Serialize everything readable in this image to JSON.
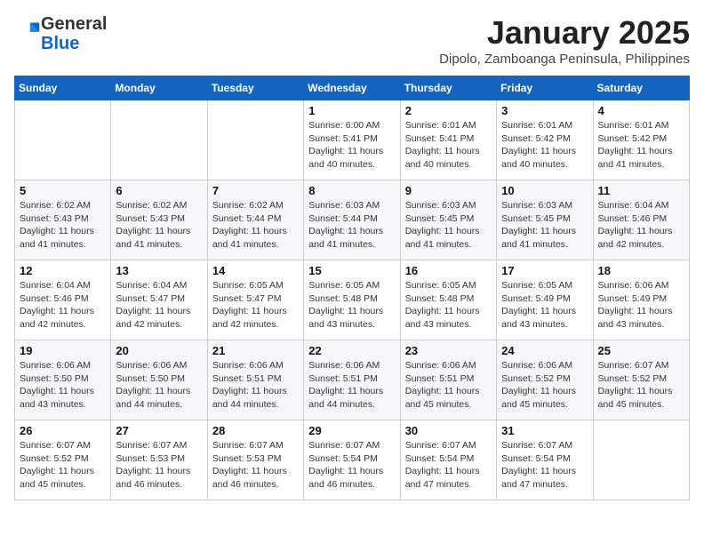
{
  "header": {
    "logo_general": "General",
    "logo_blue": "Blue",
    "month": "January 2025",
    "location": "Dipolo, Zamboanga Peninsula, Philippines"
  },
  "weekdays": [
    "Sunday",
    "Monday",
    "Tuesday",
    "Wednesday",
    "Thursday",
    "Friday",
    "Saturday"
  ],
  "weeks": [
    [
      {
        "day": "",
        "info": ""
      },
      {
        "day": "",
        "info": ""
      },
      {
        "day": "",
        "info": ""
      },
      {
        "day": "1",
        "info": "Sunrise: 6:00 AM\nSunset: 5:41 PM\nDaylight: 11 hours\nand 40 minutes."
      },
      {
        "day": "2",
        "info": "Sunrise: 6:01 AM\nSunset: 5:41 PM\nDaylight: 11 hours\nand 40 minutes."
      },
      {
        "day": "3",
        "info": "Sunrise: 6:01 AM\nSunset: 5:42 PM\nDaylight: 11 hours\nand 40 minutes."
      },
      {
        "day": "4",
        "info": "Sunrise: 6:01 AM\nSunset: 5:42 PM\nDaylight: 11 hours\nand 41 minutes."
      }
    ],
    [
      {
        "day": "5",
        "info": "Sunrise: 6:02 AM\nSunset: 5:43 PM\nDaylight: 11 hours\nand 41 minutes."
      },
      {
        "day": "6",
        "info": "Sunrise: 6:02 AM\nSunset: 5:43 PM\nDaylight: 11 hours\nand 41 minutes."
      },
      {
        "day": "7",
        "info": "Sunrise: 6:02 AM\nSunset: 5:44 PM\nDaylight: 11 hours\nand 41 minutes."
      },
      {
        "day": "8",
        "info": "Sunrise: 6:03 AM\nSunset: 5:44 PM\nDaylight: 11 hours\nand 41 minutes."
      },
      {
        "day": "9",
        "info": "Sunrise: 6:03 AM\nSunset: 5:45 PM\nDaylight: 11 hours\nand 41 minutes."
      },
      {
        "day": "10",
        "info": "Sunrise: 6:03 AM\nSunset: 5:45 PM\nDaylight: 11 hours\nand 41 minutes."
      },
      {
        "day": "11",
        "info": "Sunrise: 6:04 AM\nSunset: 5:46 PM\nDaylight: 11 hours\nand 42 minutes."
      }
    ],
    [
      {
        "day": "12",
        "info": "Sunrise: 6:04 AM\nSunset: 5:46 PM\nDaylight: 11 hours\nand 42 minutes."
      },
      {
        "day": "13",
        "info": "Sunrise: 6:04 AM\nSunset: 5:47 PM\nDaylight: 11 hours\nand 42 minutes."
      },
      {
        "day": "14",
        "info": "Sunrise: 6:05 AM\nSunset: 5:47 PM\nDaylight: 11 hours\nand 42 minutes."
      },
      {
        "day": "15",
        "info": "Sunrise: 6:05 AM\nSunset: 5:48 PM\nDaylight: 11 hours\nand 43 minutes."
      },
      {
        "day": "16",
        "info": "Sunrise: 6:05 AM\nSunset: 5:48 PM\nDaylight: 11 hours\nand 43 minutes."
      },
      {
        "day": "17",
        "info": "Sunrise: 6:05 AM\nSunset: 5:49 PM\nDaylight: 11 hours\nand 43 minutes."
      },
      {
        "day": "18",
        "info": "Sunrise: 6:06 AM\nSunset: 5:49 PM\nDaylight: 11 hours\nand 43 minutes."
      }
    ],
    [
      {
        "day": "19",
        "info": "Sunrise: 6:06 AM\nSunset: 5:50 PM\nDaylight: 11 hours\nand 43 minutes."
      },
      {
        "day": "20",
        "info": "Sunrise: 6:06 AM\nSunset: 5:50 PM\nDaylight: 11 hours\nand 44 minutes."
      },
      {
        "day": "21",
        "info": "Sunrise: 6:06 AM\nSunset: 5:51 PM\nDaylight: 11 hours\nand 44 minutes."
      },
      {
        "day": "22",
        "info": "Sunrise: 6:06 AM\nSunset: 5:51 PM\nDaylight: 11 hours\nand 44 minutes."
      },
      {
        "day": "23",
        "info": "Sunrise: 6:06 AM\nSunset: 5:51 PM\nDaylight: 11 hours\nand 45 minutes."
      },
      {
        "day": "24",
        "info": "Sunrise: 6:06 AM\nSunset: 5:52 PM\nDaylight: 11 hours\nand 45 minutes."
      },
      {
        "day": "25",
        "info": "Sunrise: 6:07 AM\nSunset: 5:52 PM\nDaylight: 11 hours\nand 45 minutes."
      }
    ],
    [
      {
        "day": "26",
        "info": "Sunrise: 6:07 AM\nSunset: 5:52 PM\nDaylight: 11 hours\nand 45 minutes."
      },
      {
        "day": "27",
        "info": "Sunrise: 6:07 AM\nSunset: 5:53 PM\nDaylight: 11 hours\nand 46 minutes."
      },
      {
        "day": "28",
        "info": "Sunrise: 6:07 AM\nSunset: 5:53 PM\nDaylight: 11 hours\nand 46 minutes."
      },
      {
        "day": "29",
        "info": "Sunrise: 6:07 AM\nSunset: 5:54 PM\nDaylight: 11 hours\nand 46 minutes."
      },
      {
        "day": "30",
        "info": "Sunrise: 6:07 AM\nSunset: 5:54 PM\nDaylight: 11 hours\nand 47 minutes."
      },
      {
        "day": "31",
        "info": "Sunrise: 6:07 AM\nSunset: 5:54 PM\nDaylight: 11 hours\nand 47 minutes."
      },
      {
        "day": "",
        "info": ""
      }
    ]
  ]
}
